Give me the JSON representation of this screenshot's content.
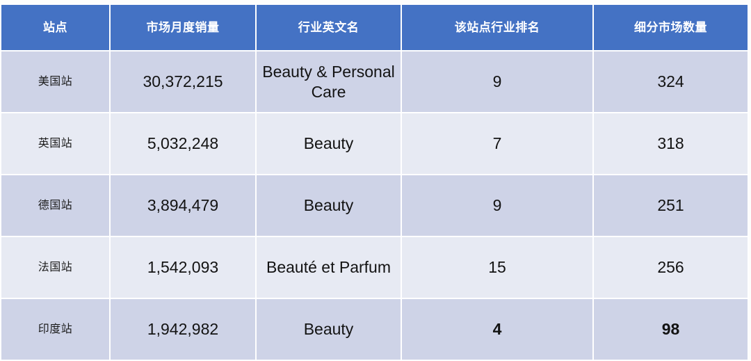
{
  "table": {
    "columns": [
      {
        "key": "site",
        "label": "站点"
      },
      {
        "key": "sales",
        "label": "市场月度销量"
      },
      {
        "key": "industry",
        "label": "行业英文名"
      },
      {
        "key": "rank",
        "label": "该站点行业排名"
      },
      {
        "key": "segments",
        "label": "细分市场数量"
      }
    ],
    "rows": [
      {
        "site": "美国站",
        "sales": "30,372,215",
        "industry": "Beauty & Personal Care",
        "rank": "9",
        "segments": "324"
      },
      {
        "site": "英国站",
        "sales": "5,032,248",
        "industry": "Beauty",
        "rank": "7",
        "segments": "318"
      },
      {
        "site": "德国站",
        "sales": "3,894,479",
        "industry": "Beauty",
        "rank": "9",
        "segments": "251"
      },
      {
        "site": "法国站",
        "sales": "1,542,093",
        "industry": "Beauté et Parfum",
        "rank": "15",
        "segments": "256"
      },
      {
        "site": "印度站",
        "sales": "1,942,982",
        "industry": "Beauty",
        "rank": "4",
        "segments": "98"
      }
    ],
    "colors": {
      "header_background": "#4472C4",
      "header_text": "#FFFFFF",
      "row_dark": "#CED3E7",
      "row_light": "#E7EAF3",
      "gridline": "#FFFFFF",
      "body_text": "#131313"
    }
  }
}
